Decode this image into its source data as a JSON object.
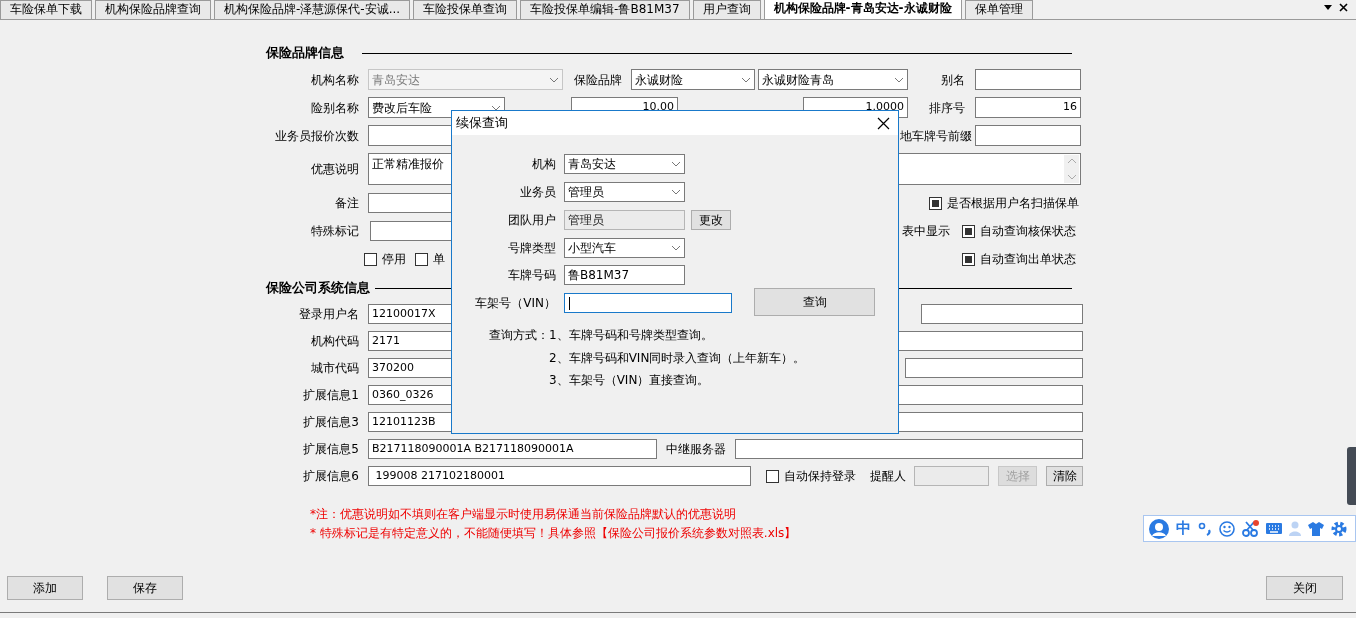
{
  "tabs": [
    {
      "label": "车险保单下载",
      "selected": false
    },
    {
      "label": "机构保险品牌查询",
      "selected": false
    },
    {
      "label": "机构保险品牌-泽慧源保代-安诚...",
      "selected": false
    },
    {
      "label": "车险投保单查询",
      "selected": false
    },
    {
      "label": "车险投保单编辑-鲁B81M37",
      "selected": false
    },
    {
      "label": "用户查询",
      "selected": false
    },
    {
      "label": "机构保险品牌-青岛安达-永诚财险",
      "selected": true
    },
    {
      "label": "保单管理",
      "selected": false
    }
  ],
  "brand_section": {
    "title": "保险品牌信息",
    "lines": [
      {
        "items": [
          {
            "kind": "label",
            "text": "机构名称"
          },
          {
            "kind": "select",
            "value": "青岛安达",
            "disabled": true
          },
          {
            "kind": "label",
            "text": "保险品牌"
          },
          {
            "kind": "select",
            "value": "永诚财险",
            "disabled": false
          },
          {
            "kind": "select",
            "value": "永诚财险青岛",
            "disabled": false
          },
          {
            "kind": "label",
            "text": "别名"
          },
          {
            "kind": "input",
            "disabled": false
          }
        ]
      },
      {
        "items": [
          {
            "kind": "label",
            "text": "险别名称"
          },
          {
            "kind": "select",
            "value": "费改后车险",
            "disabled": false
          },
          {
            "kind": "input",
            "value": "10.00",
            "disabled": false
          },
          {
            "kind": "input",
            "value": "1.0000",
            "disabled": false
          },
          {
            "kind": "label",
            "text": "排序号"
          },
          {
            "kind": "input",
            "value": "16",
            "disabled": false
          }
        ]
      },
      {
        "items": [
          {
            "kind": "label",
            "text": "业务员报价次数"
          },
          {
            "kind": "input",
            "disabled": false
          },
          {
            "kind": "label",
            "text": "地车牌号前缀"
          },
          {
            "kind": "input",
            "disabled": false
          }
        ]
      },
      {
        "items": [
          {
            "kind": "label",
            "text": "优惠说明"
          },
          {
            "kind": "textarea",
            "value": "正常精准报价",
            "disabled": false
          }
        ]
      },
      {
        "items": [
          {
            "kind": "label",
            "text": "备注"
          },
          {
            "kind": "input",
            "disabled": false
          },
          {
            "kind": "checkbox",
            "label": "是否根据用户名扫描保单",
            "checked": true
          }
        ]
      },
      {
        "items": [
          {
            "kind": "label",
            "text": "特殊标记"
          },
          {
            "kind": "input",
            "disabled": false
          },
          {
            "kind": "label",
            "text": "表中显示"
          },
          {
            "kind": "checkbox",
            "label": "自动查询核保状态",
            "checked": true
          }
        ]
      },
      {
        "items": [
          {
            "kind": "checkbox",
            "label": "停用",
            "checked": false
          },
          {
            "kind": "checkbox",
            "label": "单",
            "checked": false
          },
          {
            "kind": "checkbox",
            "label": "自动查询出单状态",
            "checked": true
          }
        ]
      }
    ]
  },
  "system_section": {
    "title": "保险公司系统信息",
    "lines": [
      {
        "items": [
          {
            "kind": "label",
            "text": "登录用户名"
          },
          {
            "kind": "input",
            "value": "12100017X",
            "disabled": false
          },
          {
            "kind": "input",
            "disabled": false
          }
        ]
      },
      {
        "items": [
          {
            "kind": "label",
            "text": "机构代码"
          },
          {
            "kind": "input",
            "value": "2171",
            "disabled": false
          },
          {
            "kind": "input",
            "disabled": false
          }
        ]
      },
      {
        "items": [
          {
            "kind": "label",
            "text": "城市代码"
          },
          {
            "kind": "input",
            "value": "370200",
            "disabled": false
          },
          {
            "kind": "input",
            "disabled": false
          }
        ]
      },
      {
        "items": [
          {
            "kind": "label",
            "text": "扩展信息1"
          },
          {
            "kind": "input",
            "value": "0360_0326",
            "disabled": false
          },
          {
            "kind": "input",
            "disabled": false
          }
        ]
      },
      {
        "items": [
          {
            "kind": "label",
            "text": "扩展信息3"
          },
          {
            "kind": "input",
            "value": "12101123B",
            "disabled": false
          },
          {
            "kind": "input",
            "disabled": false
          }
        ]
      },
      {
        "items": [
          {
            "kind": "label",
            "text": "扩展信息5"
          },
          {
            "kind": "input",
            "value": "B217118090001A B217118090001A",
            "disabled": false
          },
          {
            "kind": "label",
            "text": "中继服务器"
          },
          {
            "kind": "input",
            "disabled": false
          }
        ]
      },
      {
        "items": [
          {
            "kind": "label",
            "text": "扩展信息6"
          },
          {
            "kind": "input",
            "value": " 199008 217102180001",
            "disabled": false
          },
          {
            "kind": "checkbox",
            "label": "自动保持登录",
            "checked": false
          },
          {
            "kind": "label",
            "text": "提醒人"
          },
          {
            "kind": "input",
            "disabled": true
          },
          {
            "kind": "button",
            "text": "选择",
            "disabled": true
          },
          {
            "kind": "button",
            "text": "清除",
            "disabled": false
          }
        ]
      }
    ]
  },
  "notes": [
    "*注：优惠说明如不填则在客户端显示时使用易保通当前保险品牌默认的优惠说明",
    "* 特殊标记是有特定意义的，不能随便填写！具体参照【保险公司报价系统参数对照表.xls】"
  ],
  "footer_buttons": [
    "添加",
    "保存",
    "关闭"
  ],
  "dialog": {
    "title": "续保查询",
    "fields": [
      {
        "kind": "select",
        "label": "机构",
        "value": "青岛安达",
        "disabled": false,
        "focused": false
      },
      {
        "kind": "select",
        "label": "业务员",
        "value": "管理员",
        "disabled": false,
        "focused": false
      },
      {
        "kind": "input",
        "label": "团队用户",
        "value": "管理员",
        "disabled": true,
        "focused": false,
        "button": "更改"
      },
      {
        "kind": "select",
        "label": "号牌类型",
        "value": "小型汽车",
        "disabled": false,
        "focused": false
      },
      {
        "kind": "input",
        "label": "车牌号码",
        "value": "鲁B81M37",
        "disabled": false,
        "focused": false
      },
      {
        "kind": "input",
        "label": "车架号（VIN）",
        "disabled": false,
        "focused": true,
        "button": "查询"
      }
    ],
    "notes": [
      "查询方式：1、车牌号码和号牌类型查询。",
      "2、车牌号码和VIN同时录入查询（上年新车）。",
      "3、车架号（VIN）直接查询。"
    ]
  },
  "ime_toolbar": {
    "mode": "中"
  }
}
